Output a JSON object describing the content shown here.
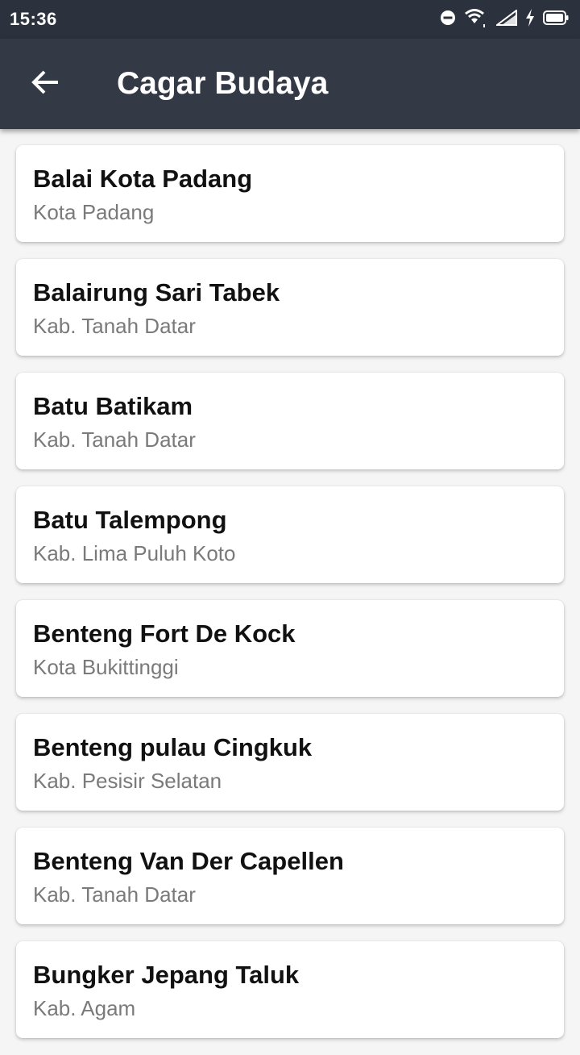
{
  "status_bar": {
    "time": "15:36",
    "icons": [
      "do-not-disturb-icon",
      "wifi-icon",
      "signal-icon",
      "charging-icon",
      "battery-icon"
    ]
  },
  "app_bar": {
    "title": "Cagar Budaya",
    "back_icon": "arrow-back-icon",
    "background": "#343a45"
  },
  "items": [
    {
      "name": "Balai Kota Padang",
      "location": "Kota Padang"
    },
    {
      "name": "Balairung Sari Tabek",
      "location": "Kab. Tanah Datar"
    },
    {
      "name": "Batu Batikam",
      "location": "Kab. Tanah Datar"
    },
    {
      "name": "Batu Talempong",
      "location": "Kab. Lima Puluh Koto"
    },
    {
      "name": "Benteng Fort De Kock",
      "location": "Kota Bukittinggi"
    },
    {
      "name": "Benteng pulau Cingkuk",
      "location": "Kab. Pesisir Selatan"
    },
    {
      "name": "Benteng Van Der Capellen",
      "location": "Kab. Tanah Datar"
    },
    {
      "name": "Bungker Jepang Taluk",
      "location": "Kab. Agam"
    }
  ]
}
